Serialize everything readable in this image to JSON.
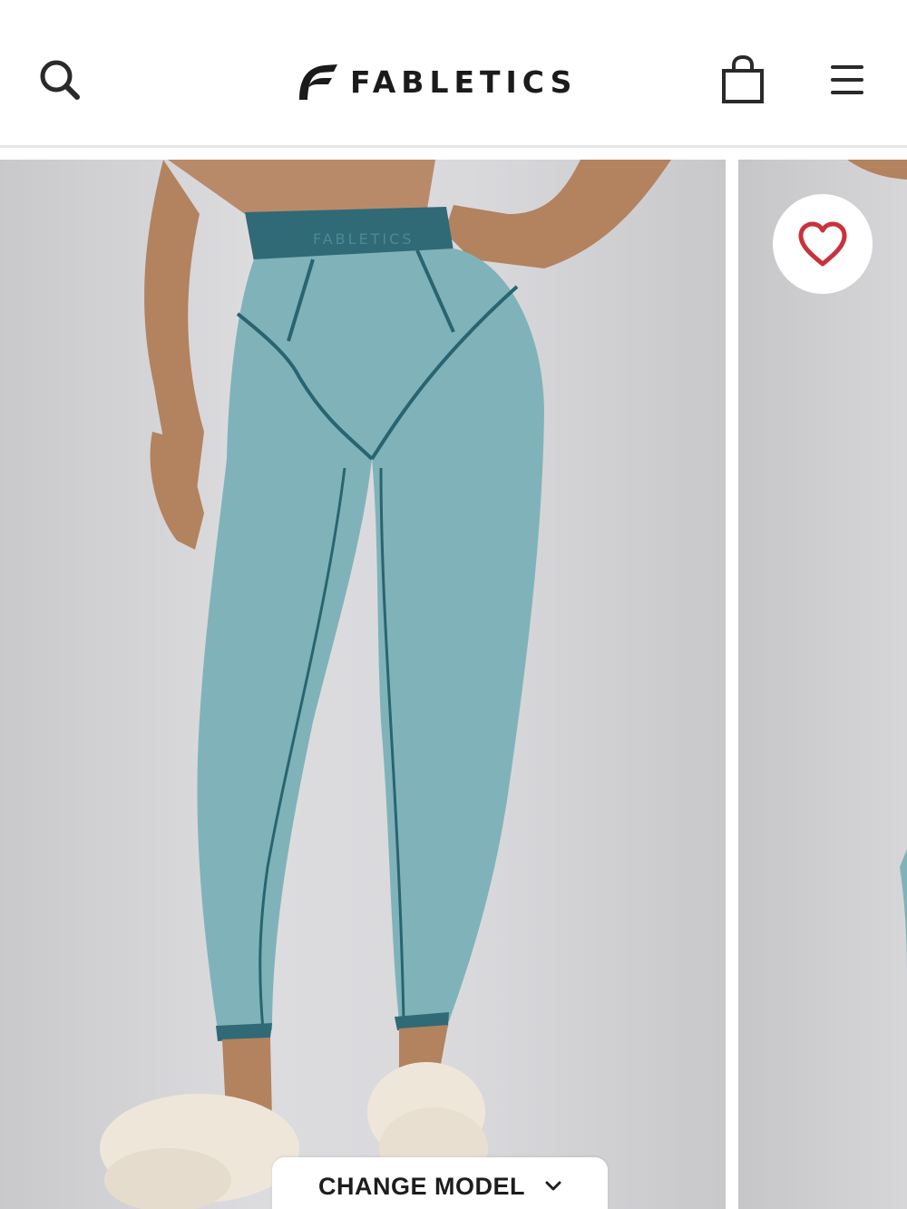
{
  "header": {
    "brand_name": "FABLETICS",
    "search_icon": "search-icon",
    "bag_icon": "shopping-bag-icon",
    "menu_icon": "hamburger-menu-icon"
  },
  "product": {
    "waistband_text": "FABLETICS",
    "favorite_icon": "heart-icon"
  },
  "gallery": {
    "change_model_label": "CHANGE MODEL",
    "change_model_icon": "chevron-down-icon"
  },
  "colors": {
    "legging": "#7fb3b9",
    "waistband": "#2f6a76",
    "heart": "#c8323c",
    "background": "#d8d8db"
  }
}
